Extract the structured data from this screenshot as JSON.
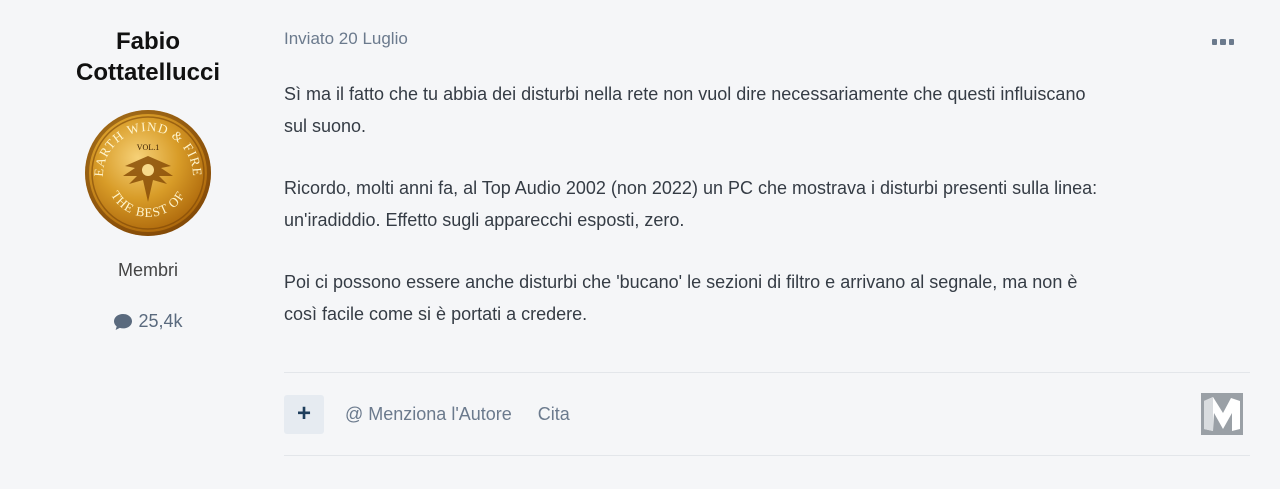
{
  "author": {
    "name_line1": "Fabio",
    "name_line2": "Cottatellucci",
    "avatar_text": [
      "EARTH WIND & FIRE",
      "VOL.1",
      "THE BEST OF"
    ],
    "group": "Membri",
    "post_count": "25,4k",
    "post_count_icon": "comment-icon"
  },
  "post": {
    "date": "Inviato 20 Luglio",
    "more_icon": "more-options-icon",
    "paragraphs": [
      {
        "line1": "Sì ma il fatto che tu abbia dei disturbi nella rete non vuol dire necessariamente che questi influiscano",
        "line2": "sul suono."
      },
      {
        "line1": "Ricordo, molti anni fa, al Top Audio 2002 (non 2022) un PC che mostrava i disturbi presenti sulla linea:",
        "line2": "un'iradiddio. Effetto sugli apparecchi esposti, zero."
      },
      {
        "line1": "Poi ci possono essere anche disturbi che 'bucano' le sezioni di filtro e arrivano al segnale, ma non è",
        "line2": "così facile come si è portati a credere."
      }
    ]
  },
  "actions": {
    "plus_label": "+",
    "mention_label": "@ Menziona l'Autore",
    "quote_label": "Cita"
  },
  "colors": {
    "background": "#f5f6f8",
    "meta_text": "#6b7a8d",
    "button_bg": "#e6ebf1",
    "button_fg": "#1f3e5c"
  }
}
